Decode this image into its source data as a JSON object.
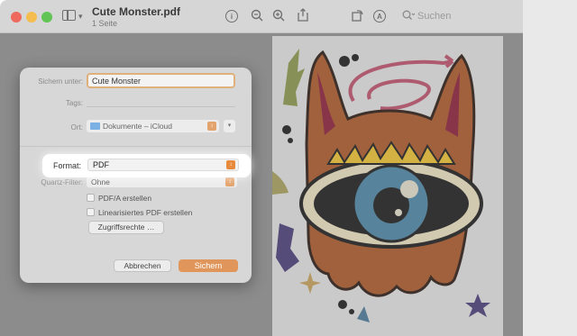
{
  "window": {
    "title": "Cute Monster.pdf",
    "subtitle": "1 Seite",
    "search_placeholder": "Suchen"
  },
  "dialog": {
    "save_as_label": "Sichern unter:",
    "save_as_value": "Cute Monster",
    "tags_label": "Tags:",
    "location_label": "Ort:",
    "location_value": "Dokumente – iCloud",
    "format_label": "Format:",
    "format_value": "PDF",
    "quartz_label": "Quartz-Filter:",
    "quartz_value": "Ohne",
    "pdfa_label": "PDF/A erstellen",
    "linearized_label": "Linearisiertes PDF erstellen",
    "permissions_button": "Zugriffsrechte …",
    "cancel_button": "Abbrechen",
    "save_button": "Sichern"
  },
  "colors": {
    "accent": "#e0955a",
    "stepper": "#e88a3c",
    "backdrop": "#8c8c8c"
  },
  "icons": [
    "sidebar-toggle-icon",
    "chevron-down-icon",
    "info-icon",
    "zoom-out-icon",
    "zoom-in-icon",
    "share-icon",
    "rotate-icon",
    "markup-icon",
    "search-icon",
    "folder-icon"
  ]
}
